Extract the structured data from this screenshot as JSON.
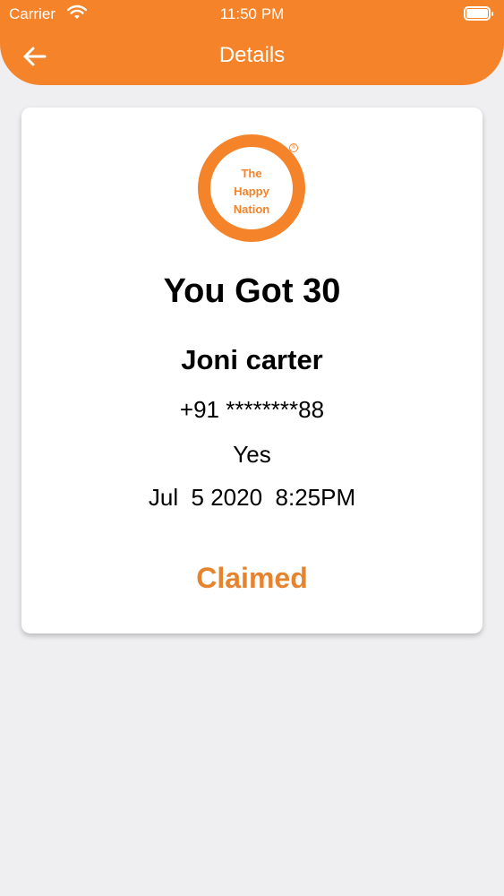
{
  "status_bar": {
    "carrier": "Carrier",
    "time": "11:50 PM"
  },
  "header": {
    "title": "Details",
    "back_icon": "arrow-left-icon"
  },
  "colors": {
    "accent": "#f5832a",
    "claimed": "#e6842e",
    "background": "#efeff1"
  },
  "card": {
    "logo": {
      "line1": "The",
      "line2": "Happy",
      "line3": "Nation",
      "reg_mark": "®"
    },
    "reward": "You Got 30",
    "name": "Joni carter",
    "phone": "+91 ********88",
    "answer": "Yes",
    "datetime": "Jul  5 2020  8:25PM",
    "status": "Claimed"
  }
}
